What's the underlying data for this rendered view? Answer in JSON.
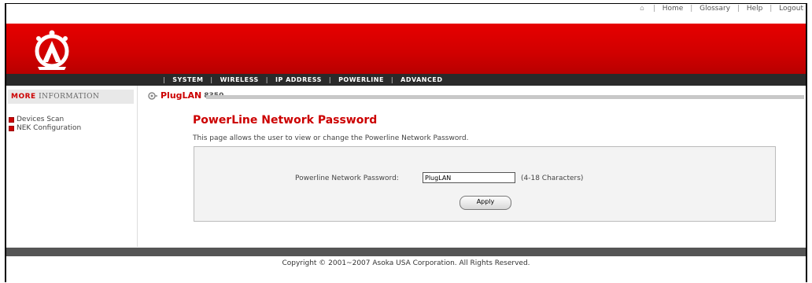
{
  "toplinks": {
    "home": "Home",
    "glossary": "Glossary",
    "help": "Help",
    "logout": "Logout",
    "sep": "|"
  },
  "nav": {
    "system": "SYSTEM",
    "wireless": "WIRELESS",
    "ip_address": "IP ADDRESS",
    "powerline": "POWERLINE",
    "advanced": "ADVANCED",
    "sep": "|"
  },
  "sidebar": {
    "header_bold": "MORE",
    "header_rest": "INFORMATION",
    "items": [
      {
        "label": "Devices Scan"
      },
      {
        "label": "NEK Configuration"
      }
    ]
  },
  "product": {
    "name": "PlugLAN",
    "model": "8350"
  },
  "main": {
    "title": "PowerLine Network Password",
    "description": "This page allows the user to view or change the Powerline Network Password.",
    "password_label": "Powerline Network Password:",
    "password_value": "PlugLAN",
    "password_hint": "(4-18 Characters)",
    "apply_label": "Apply"
  },
  "footer": {
    "copyright": "Copyright © 2001~2007 Asoka USA Corporation. All Rights Reserved."
  },
  "colors": {
    "brand_red": "#d00000",
    "nav_bg": "#2a2a2a",
    "accent_red": "#cc0000"
  }
}
